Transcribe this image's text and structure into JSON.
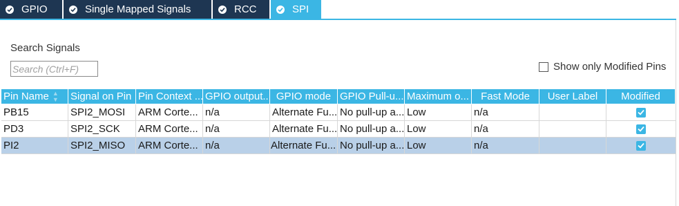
{
  "tabs": [
    {
      "label": "GPIO",
      "active": false
    },
    {
      "label": "Single Mapped Signals",
      "active": false
    },
    {
      "label": "RCC",
      "active": false
    },
    {
      "label": "SPI",
      "active": true
    }
  ],
  "search": {
    "label": "Search Signals",
    "placeholder": "Search (Ctrl+F)",
    "value": ""
  },
  "filter": {
    "label": "Show only Modified Pins",
    "checked": false
  },
  "table": {
    "columns": [
      "Pin Name",
      "Signal on Pin",
      "Pin Context ...",
      "GPIO output...",
      "GPIO mode",
      "GPIO Pull-u...",
      "Maximum o...",
      "Fast Mode",
      "User Label",
      "Modified"
    ],
    "sorted_column": "Pin Name",
    "rows": [
      {
        "pin": "PB15",
        "signal": "SPI2_MOSI",
        "context": "ARM Corte...",
        "output": "n/a",
        "mode": "Alternate Fu...",
        "pull": "No pull-up a...",
        "max": "Low",
        "fast": "n/a",
        "label": "",
        "modified": true,
        "selected": false
      },
      {
        "pin": "PD3",
        "signal": "SPI2_SCK",
        "context": "ARM Corte...",
        "output": "n/a",
        "mode": "Alternate Fu...",
        "pull": "No pull-up a...",
        "max": "Low",
        "fast": "n/a",
        "label": "",
        "modified": true,
        "selected": false
      },
      {
        "pin": "PI2",
        "signal": "SPI2_MISO",
        "context": "ARM Corte...",
        "output": "n/a",
        "mode": "Alternate Fu...",
        "pull": "No pull-up a...",
        "max": "Low",
        "fast": "n/a",
        "label": "",
        "modified": true,
        "selected": true
      }
    ]
  },
  "colors": {
    "tab_inactive": "#1e3652",
    "tab_active": "#3bb6e4",
    "header": "#3bb6e4",
    "selected_row": "#b9d0e8"
  },
  "icons": {
    "tab_status": "check-circle-icon",
    "sort": "sort-arrows-icon",
    "modified": "checkbox-checked-icon"
  }
}
